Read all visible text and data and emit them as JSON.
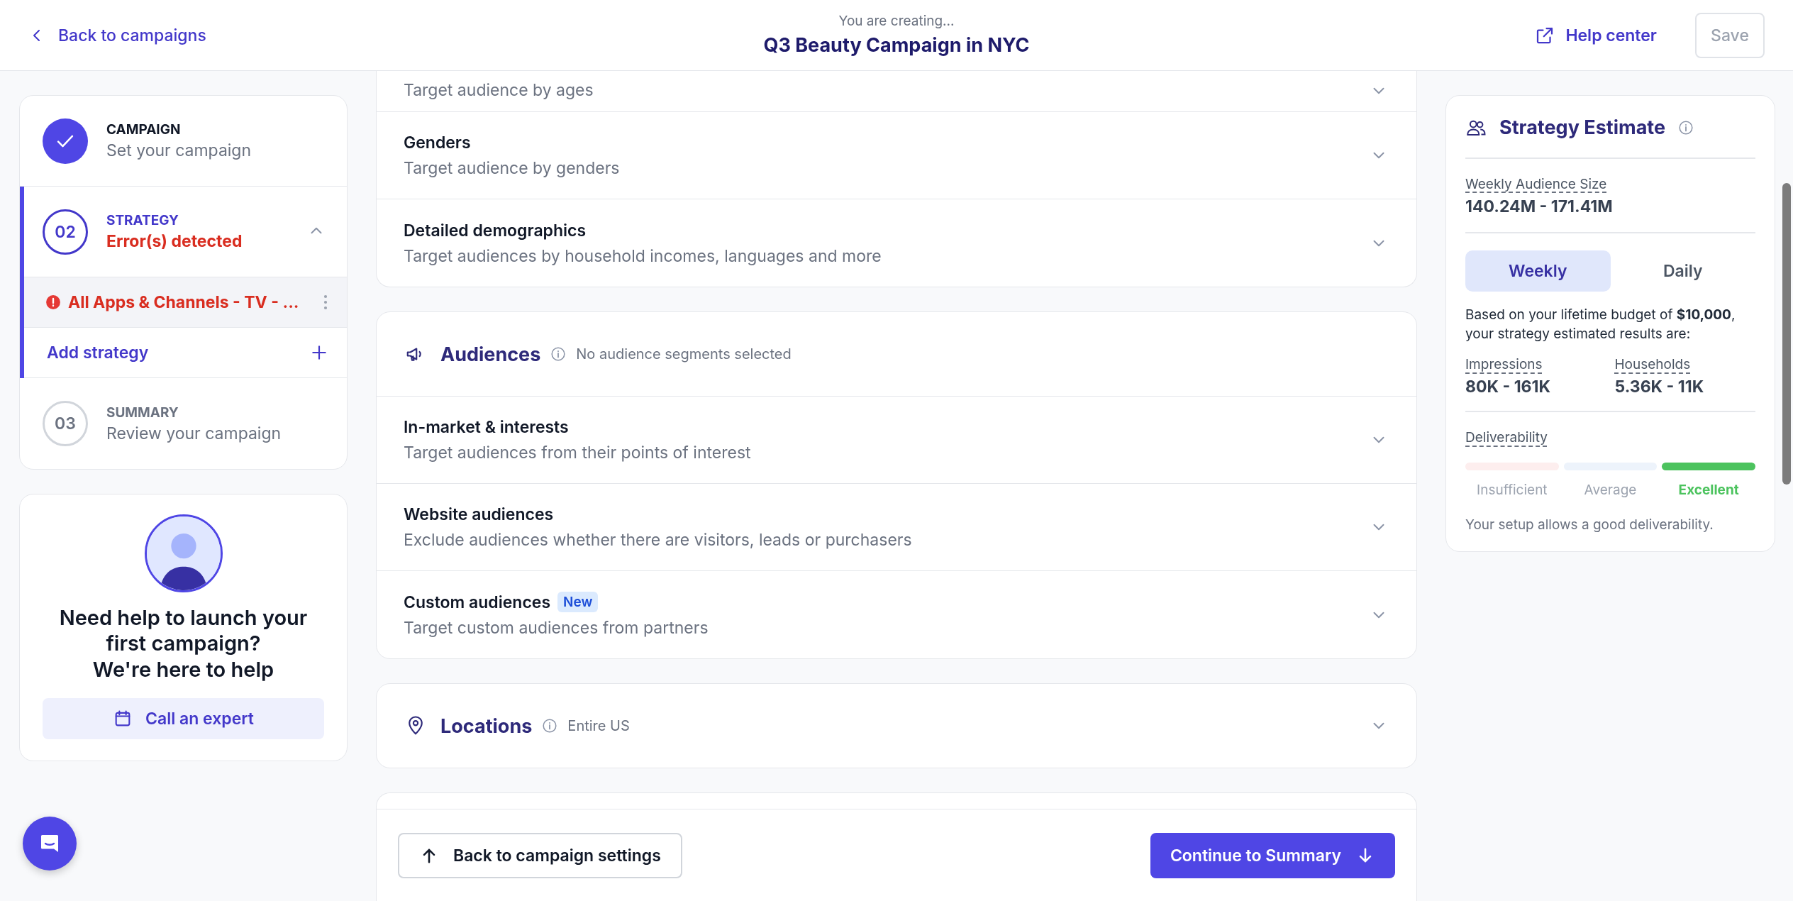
{
  "header": {
    "back_link": "Back to campaigns",
    "subtitle": "You are creating...",
    "title": "Q3 Beauty Campaign in NYC",
    "help_link": "Help center",
    "save_button": {
      "label": "Save",
      "disabled": true
    }
  },
  "steps": [
    {
      "kind": "done",
      "label": "CAMPAIGN",
      "description": "Set your campaign"
    },
    {
      "kind": "active",
      "number": "02",
      "label": "STRATEGY",
      "status": "Error(s) detected",
      "expanded": true,
      "strategies": [
        {
          "name": "All Apps & Channels - TV - ...",
          "error": true
        }
      ],
      "add_label": "Add strategy"
    },
    {
      "kind": "pending",
      "number": "03",
      "label": "SUMMARY",
      "description": "Review your campaign"
    }
  ],
  "help_card": {
    "title": "Need help to launch your first campaign?",
    "subtitle": "We're here to help",
    "button": "Call an expert"
  },
  "sections": [
    {
      "kind": "rows",
      "rows": [
        {
          "subtitle": "Target audience by ages"
        },
        {
          "title": "Genders",
          "subtitle": "Target audience by genders"
        },
        {
          "title": "Detailed demographics",
          "subtitle": "Target audiences by household incomes, languages and more"
        }
      ]
    },
    {
      "kind": "group",
      "title": "Audiences",
      "note": "No audience segments selected",
      "rows": [
        {
          "title": "In-market & interests",
          "subtitle": "Target audiences from their points of interest"
        },
        {
          "title": "Website audiences",
          "subtitle": "Exclude audiences whether there are visitors, leads or purchasers"
        },
        {
          "title": "Custom audiences",
          "badge": "New",
          "subtitle": "Target custom audiences from partners"
        }
      ]
    },
    {
      "kind": "collapsed",
      "title": "Locations",
      "note": "Entire US"
    }
  ],
  "footer": {
    "back_button": "Back to campaign settings",
    "continue_button": "Continue to Summary"
  },
  "estimate": {
    "title": "Strategy Estimate",
    "audience_label": "Weekly Audience Size",
    "audience_value": "140.24M - 171.41M",
    "tabs": [
      {
        "label": "Weekly",
        "selected": true
      },
      {
        "label": "Daily",
        "selected": false
      }
    ],
    "budget_text": "Based on your lifetime budget of **$10,000**, your strategy estimated results are:",
    "metrics": [
      {
        "label": "Impressions",
        "value": "80K - 161K"
      },
      {
        "label": "Households",
        "value": "5.36K - 11K"
      }
    ],
    "deliverability_label": "Deliverability",
    "levels": [
      {
        "label": "Insufficient",
        "selected": false,
        "color": "#fdeeee"
      },
      {
        "label": "Average",
        "selected": false,
        "color": "#edf3fb"
      },
      {
        "label": "Excellent",
        "selected": true,
        "color": "#4cc35e"
      }
    ],
    "deliverability_note": "Your setup allows a good deliverability."
  }
}
